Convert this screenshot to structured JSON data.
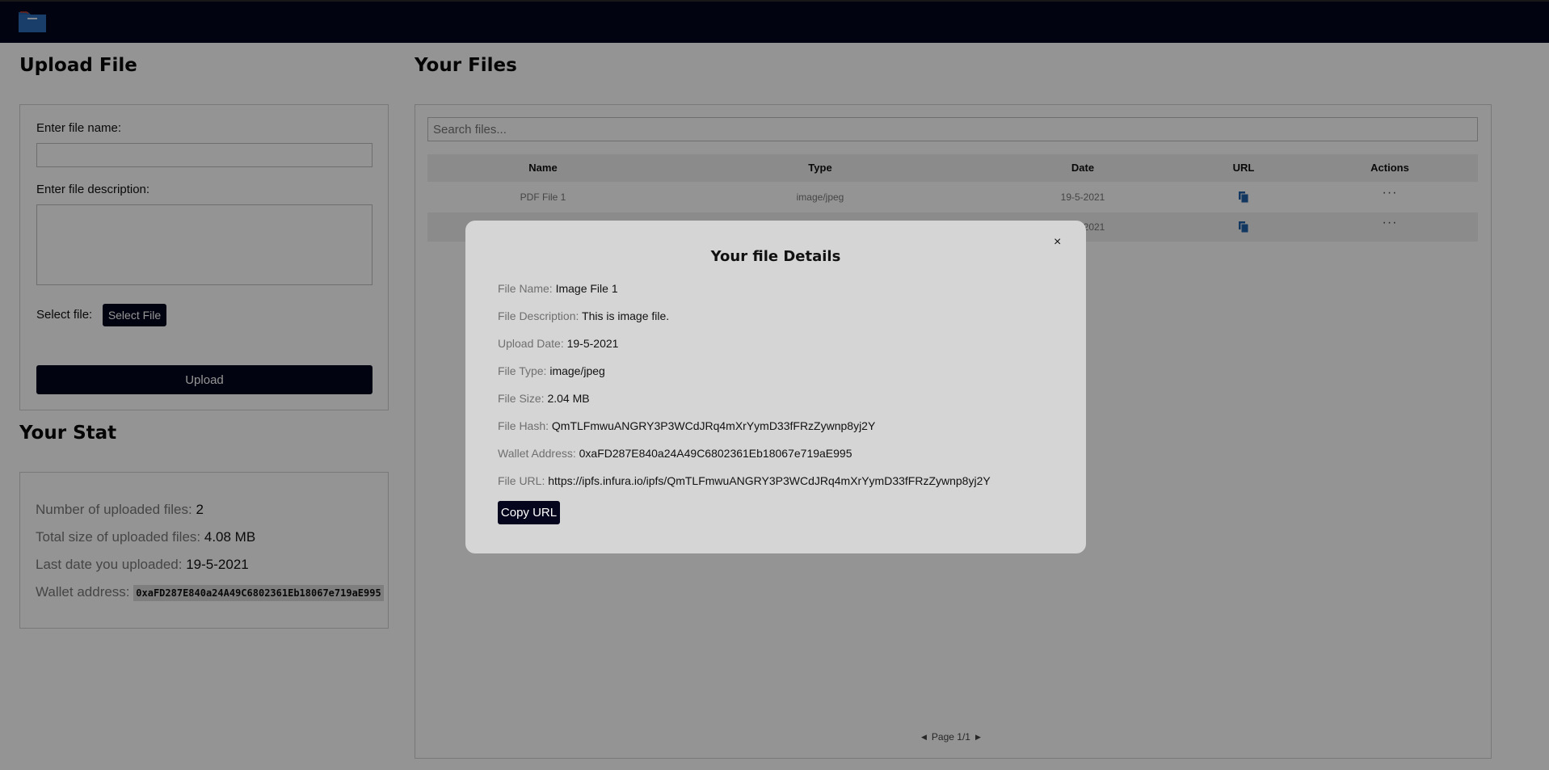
{
  "header": {
    "logo_icon": "folder-icon"
  },
  "upload": {
    "title": "Upload File",
    "name_label": "Enter file name:",
    "name_value": "",
    "desc_label": "Enter file description:",
    "desc_value": "",
    "select_label": "Select file:",
    "select_button": "Select File",
    "upload_button": "Upload"
  },
  "stats": {
    "title": "Your Stat",
    "count_label": "Number of uploaded files:",
    "count_value": "2",
    "size_label": "Total size of uploaded files:",
    "size_value": "4.08 MB",
    "last_label": "Last date you uploaded:",
    "last_value": "19-5-2021",
    "wallet_label": "Wallet address:",
    "wallet_value": "0xaFD287E840a24A49C6802361Eb18067e719aE995"
  },
  "files": {
    "title": "Your Files",
    "search_placeholder": "Search files...",
    "columns": [
      "Name",
      "Type",
      "Date",
      "URL",
      "Actions"
    ],
    "rows": [
      {
        "name": "PDF File 1",
        "type": "image/jpeg",
        "date": "19-5-2021",
        "actions": "···"
      },
      {
        "name": "",
        "type": "",
        "date": "19-5-2021",
        "actions": "···"
      }
    ],
    "pagination": "Page 1/1"
  },
  "modal": {
    "title": "Your file Details",
    "close": "×",
    "fields": [
      {
        "label": "File Name:",
        "value": "Image File 1"
      },
      {
        "label": "File Description:",
        "value": "This is image file."
      },
      {
        "label": "Upload Date:",
        "value": "19-5-2021"
      },
      {
        "label": "File Type:",
        "value": "image/jpeg"
      },
      {
        "label": "File Size:",
        "value": "2.04 MB"
      },
      {
        "label": "File Hash:",
        "value": "QmTLFmwuANGRY3P3WCdJRq4mXrYymD33fFRzZywnp8yj2Y"
      },
      {
        "label": "Wallet Address:",
        "value": "0xaFD287E840a24A49C6802361Eb18067e719aE995"
      },
      {
        "label": "File URL:",
        "value": "https://ipfs.infura.io/ipfs/QmTLFmwuANGRY3P3WCdJRq4mXrYymD33fFRzZywnp8yj2Y"
      }
    ],
    "copy_button": "Copy URL"
  },
  "colors": {
    "navy": "#05061e",
    "overlay": "rgba(0,0,0,0.42)",
    "modal_bg": "#d5d5d5",
    "icon_blue": "#1f5fa8"
  }
}
